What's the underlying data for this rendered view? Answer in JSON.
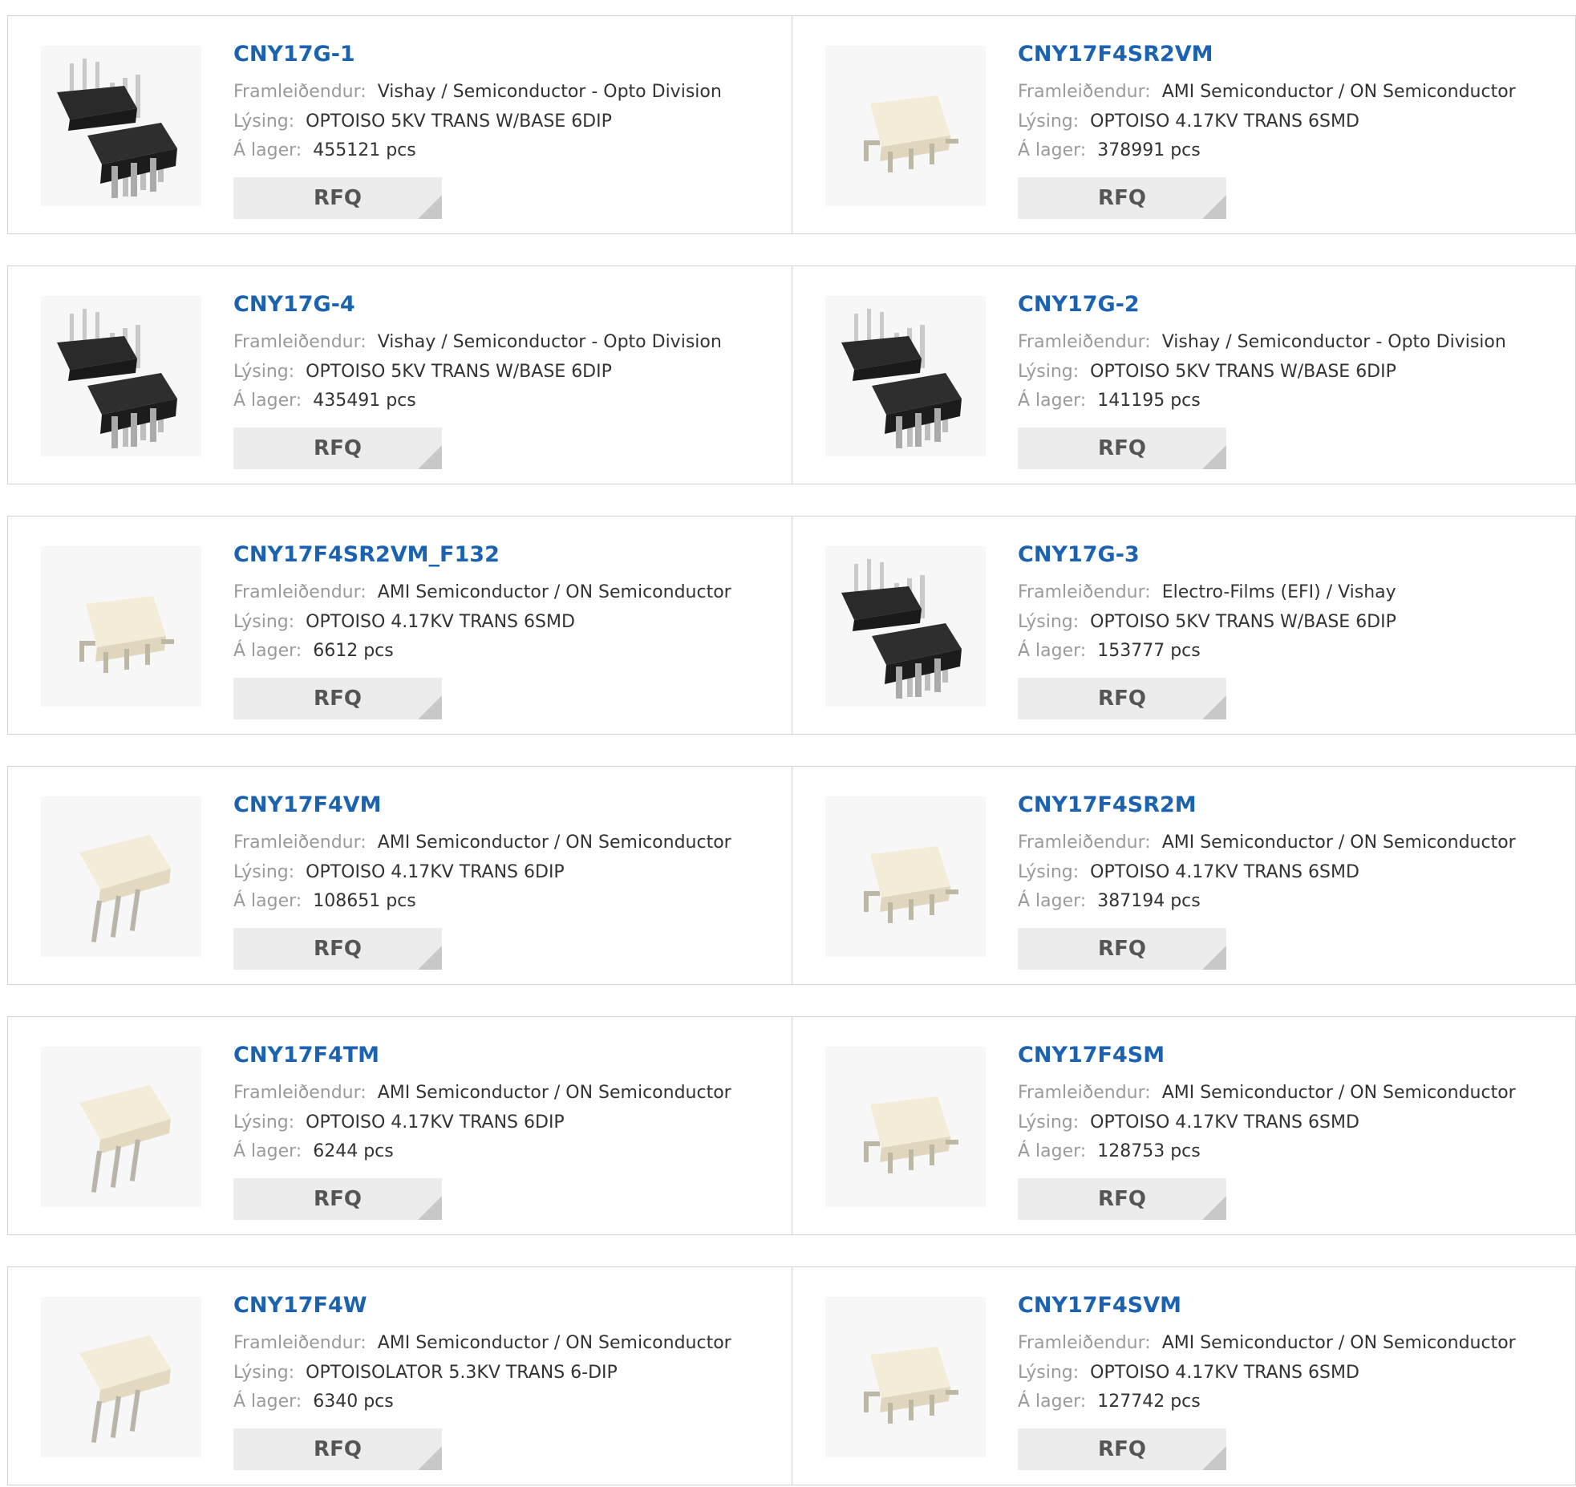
{
  "labels": {
    "manufacturer": "Framleiðendur:",
    "description": "Lýsing:",
    "stock": "Á lager:",
    "rfq": "RFQ"
  },
  "products": [
    {
      "pn": "CNY17G-1",
      "manufacturer": "Vishay / Semiconductor - Opto Division",
      "description": "OPTOISO 5KV TRANS W/BASE 6DIP",
      "stock": "455121 pcs",
      "icon": "black-dip-chip-icon"
    },
    {
      "pn": "CNY17F4SR2VM",
      "manufacturer": "AMI Semiconductor / ON Semiconductor",
      "description": "OPTOISO 4.17KV TRANS 6SMD",
      "stock": "378991 pcs",
      "icon": "white-smd-chip-icon"
    },
    {
      "pn": "CNY17G-4",
      "manufacturer": "Vishay / Semiconductor - Opto Division",
      "description": "OPTOISO 5KV TRANS W/BASE 6DIP",
      "stock": "435491 pcs",
      "icon": "black-dip-chip-icon"
    },
    {
      "pn": "CNY17G-2",
      "manufacturer": "Vishay / Semiconductor - Opto Division",
      "description": "OPTOISO 5KV TRANS W/BASE 6DIP",
      "stock": "141195 pcs",
      "icon": "black-dip-chip-icon"
    },
    {
      "pn": "CNY17F4SR2VM_F132",
      "manufacturer": "AMI Semiconductor / ON Semiconductor",
      "description": "OPTOISO 4.17KV TRANS 6SMD",
      "stock": "6612 pcs",
      "icon": "white-smd-chip-icon"
    },
    {
      "pn": "CNY17G-3",
      "manufacturer": "Electro-Films (EFI) / Vishay",
      "description": "OPTOISO 5KV TRANS W/BASE 6DIP",
      "stock": "153777 pcs",
      "icon": "black-dip-chip-icon"
    },
    {
      "pn": "CNY17F4VM",
      "manufacturer": "AMI Semiconductor / ON Semiconductor",
      "description": "OPTOISO 4.17KV TRANS 6DIP",
      "stock": "108651 pcs",
      "icon": "white-dip-chip-icon"
    },
    {
      "pn": "CNY17F4SR2M",
      "manufacturer": "AMI Semiconductor / ON Semiconductor",
      "description": "OPTOISO 4.17KV TRANS 6SMD",
      "stock": "387194 pcs",
      "icon": "white-smd-chip-icon"
    },
    {
      "pn": "CNY17F4TM",
      "manufacturer": "AMI Semiconductor / ON Semiconductor",
      "description": "OPTOISO 4.17KV TRANS 6DIP",
      "stock": "6244 pcs",
      "icon": "white-dip-chip-icon"
    },
    {
      "pn": "CNY17F4SM",
      "manufacturer": "AMI Semiconductor / ON Semiconductor",
      "description": "OPTOISO 4.17KV TRANS 6SMD",
      "stock": "128753 pcs",
      "icon": "white-smd-chip-icon"
    },
    {
      "pn": "CNY17F4W",
      "manufacturer": "AMI Semiconductor / ON Semiconductor",
      "description": "OPTOISOLATOR 5.3KV TRANS 6-DIP",
      "stock": "6340 pcs",
      "icon": "white-dip-chip-icon"
    },
    {
      "pn": "CNY17F4SVM",
      "manufacturer": "AMI Semiconductor / ON Semiconductor",
      "description": "OPTOISO 4.17KV TRANS 6SMD",
      "stock": "127742 pcs",
      "icon": "white-smd-chip-icon"
    }
  ]
}
